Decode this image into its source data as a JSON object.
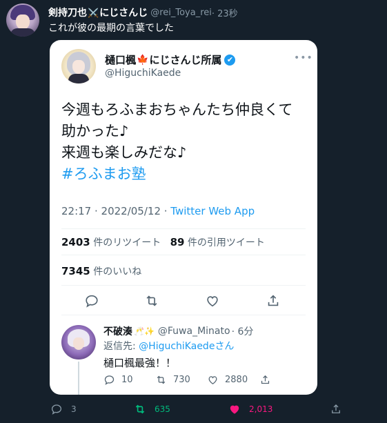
{
  "outer_tweet": {
    "display_name": "剣持刀也",
    "name_emoji": "⚔️",
    "name_suffix": "にじさんじ",
    "handle": "@rei_Toya_rei",
    "time": " · 23秒",
    "text": "これが彼の最期の言葉でした",
    "actions": {
      "reply_count": "3",
      "retweet_count": "635",
      "like_count": "2,013"
    }
  },
  "quoted_tweet": {
    "display_name": "樋口楓",
    "name_emoji": "🍁",
    "name_suffix": "にじさんじ所属",
    "verified_mark": "✔",
    "handle": "@HiguchiKaede",
    "more": "•••",
    "body_lines": [
      "今週もろふまおちゃんたち仲良くて",
      "助かった♪",
      "来週も楽しみだな♪"
    ],
    "hashtag": "#ろふまお塾",
    "timestamp": "22:17 · 2022/05/12 · ",
    "source": "Twitter Web App",
    "retweets": "2403",
    "retweets_label": "件のリツイート",
    "quotes": "89",
    "quotes_label": "件の引用ツイート",
    "likes": "7345",
    "likes_label": "件のいいね"
  },
  "reply": {
    "display_name": "不破湊",
    "name_emoji": "🥂✨",
    "handle": "@Fuwa_Minato",
    "time": "· 6分",
    "replying_to_label": "返信先: ",
    "replying_to_handle": "@HiguchiKaede",
    "replying_to_suffix": "さん",
    "text": "樋口楓最強！！",
    "reply_count": "10",
    "retweet_count": "730",
    "like_count": "2880"
  },
  "colors": {
    "background": "#15202b",
    "accent": "#1d9bf0",
    "retweet": "#00ba7c",
    "like": "#f91880"
  },
  "icons": [
    "reply-icon",
    "retweet-icon",
    "like-icon",
    "share-icon",
    "verified-badge-icon",
    "more-icon"
  ]
}
